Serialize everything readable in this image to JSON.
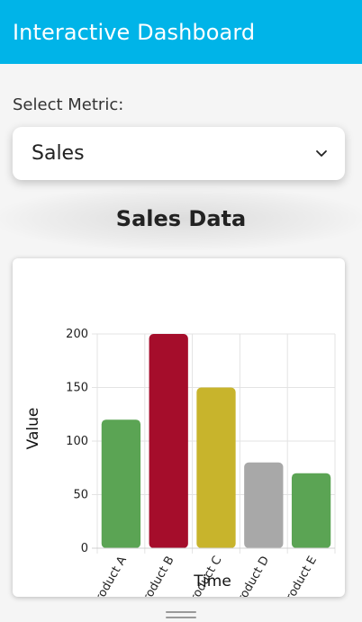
{
  "header": {
    "title": "Interactive Dashboard",
    "background": "#00b4e8"
  },
  "metric_select": {
    "label": "Select Metric:",
    "selected": "Sales",
    "icon": "chevron-down-icon"
  },
  "section": {
    "title": "Sales Data"
  },
  "chart_data": {
    "type": "bar",
    "categories": [
      "Product A",
      "Product B",
      "Product C",
      "Product D",
      "Product E"
    ],
    "values": [
      120,
      200,
      150,
      80,
      70
    ],
    "colors": [
      "#5ba454",
      "#a50d2b",
      "#c8b42c",
      "#a8a8a8",
      "#5ba454"
    ],
    "xlabel": "Time",
    "ylabel": "Value",
    "ylim": [
      0,
      200
    ],
    "yticks": [
      0,
      50,
      100,
      150,
      200
    ],
    "grid": true,
    "legend": "none"
  }
}
